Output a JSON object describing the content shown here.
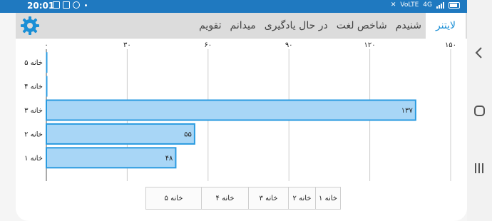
{
  "status_bar": {
    "time": "20:01",
    "network_text": "4G",
    "volte_text": "VoLTE"
  },
  "tabs": [
    {
      "label": "لایتنر",
      "active": true
    },
    {
      "label": "شنیدم",
      "active": false
    },
    {
      "label": "شاخص لغت",
      "active": false
    },
    {
      "label": "در حال یادگیری",
      "active": false
    },
    {
      "label": "میدانم",
      "active": false
    },
    {
      "label": "تقویم",
      "active": false
    }
  ],
  "colors": {
    "accent": "#1a8fd6",
    "bar_fill": "#a8d6f6",
    "bar_stroke": "#2a9be0",
    "status_bar": "#1f79c0"
  },
  "chart_data": {
    "type": "bar",
    "orientation": "horizontal",
    "categories": [
      "خانه ۵",
      "خانه ۴",
      "خانه ۳",
      "خانه ۲",
      "خانه ۱"
    ],
    "values": [
      0,
      0,
      137,
      55,
      48
    ],
    "value_labels": [
      "",
      "",
      "۱۳۷",
      "۵۵",
      "۴۸"
    ],
    "xlim": [
      0,
      150
    ],
    "ticks": [
      0,
      30,
      60,
      90,
      120,
      150
    ],
    "tick_labels": [
      "۰",
      "۳۰",
      "۶۰",
      "۹۰",
      "۱۲۰",
      "۱۵۰"
    ],
    "grid": true
  },
  "legend": [
    "خانه ۱",
    "خانه ۲",
    "خانه ۳",
    "خانه ۴",
    "خانه ۵"
  ]
}
